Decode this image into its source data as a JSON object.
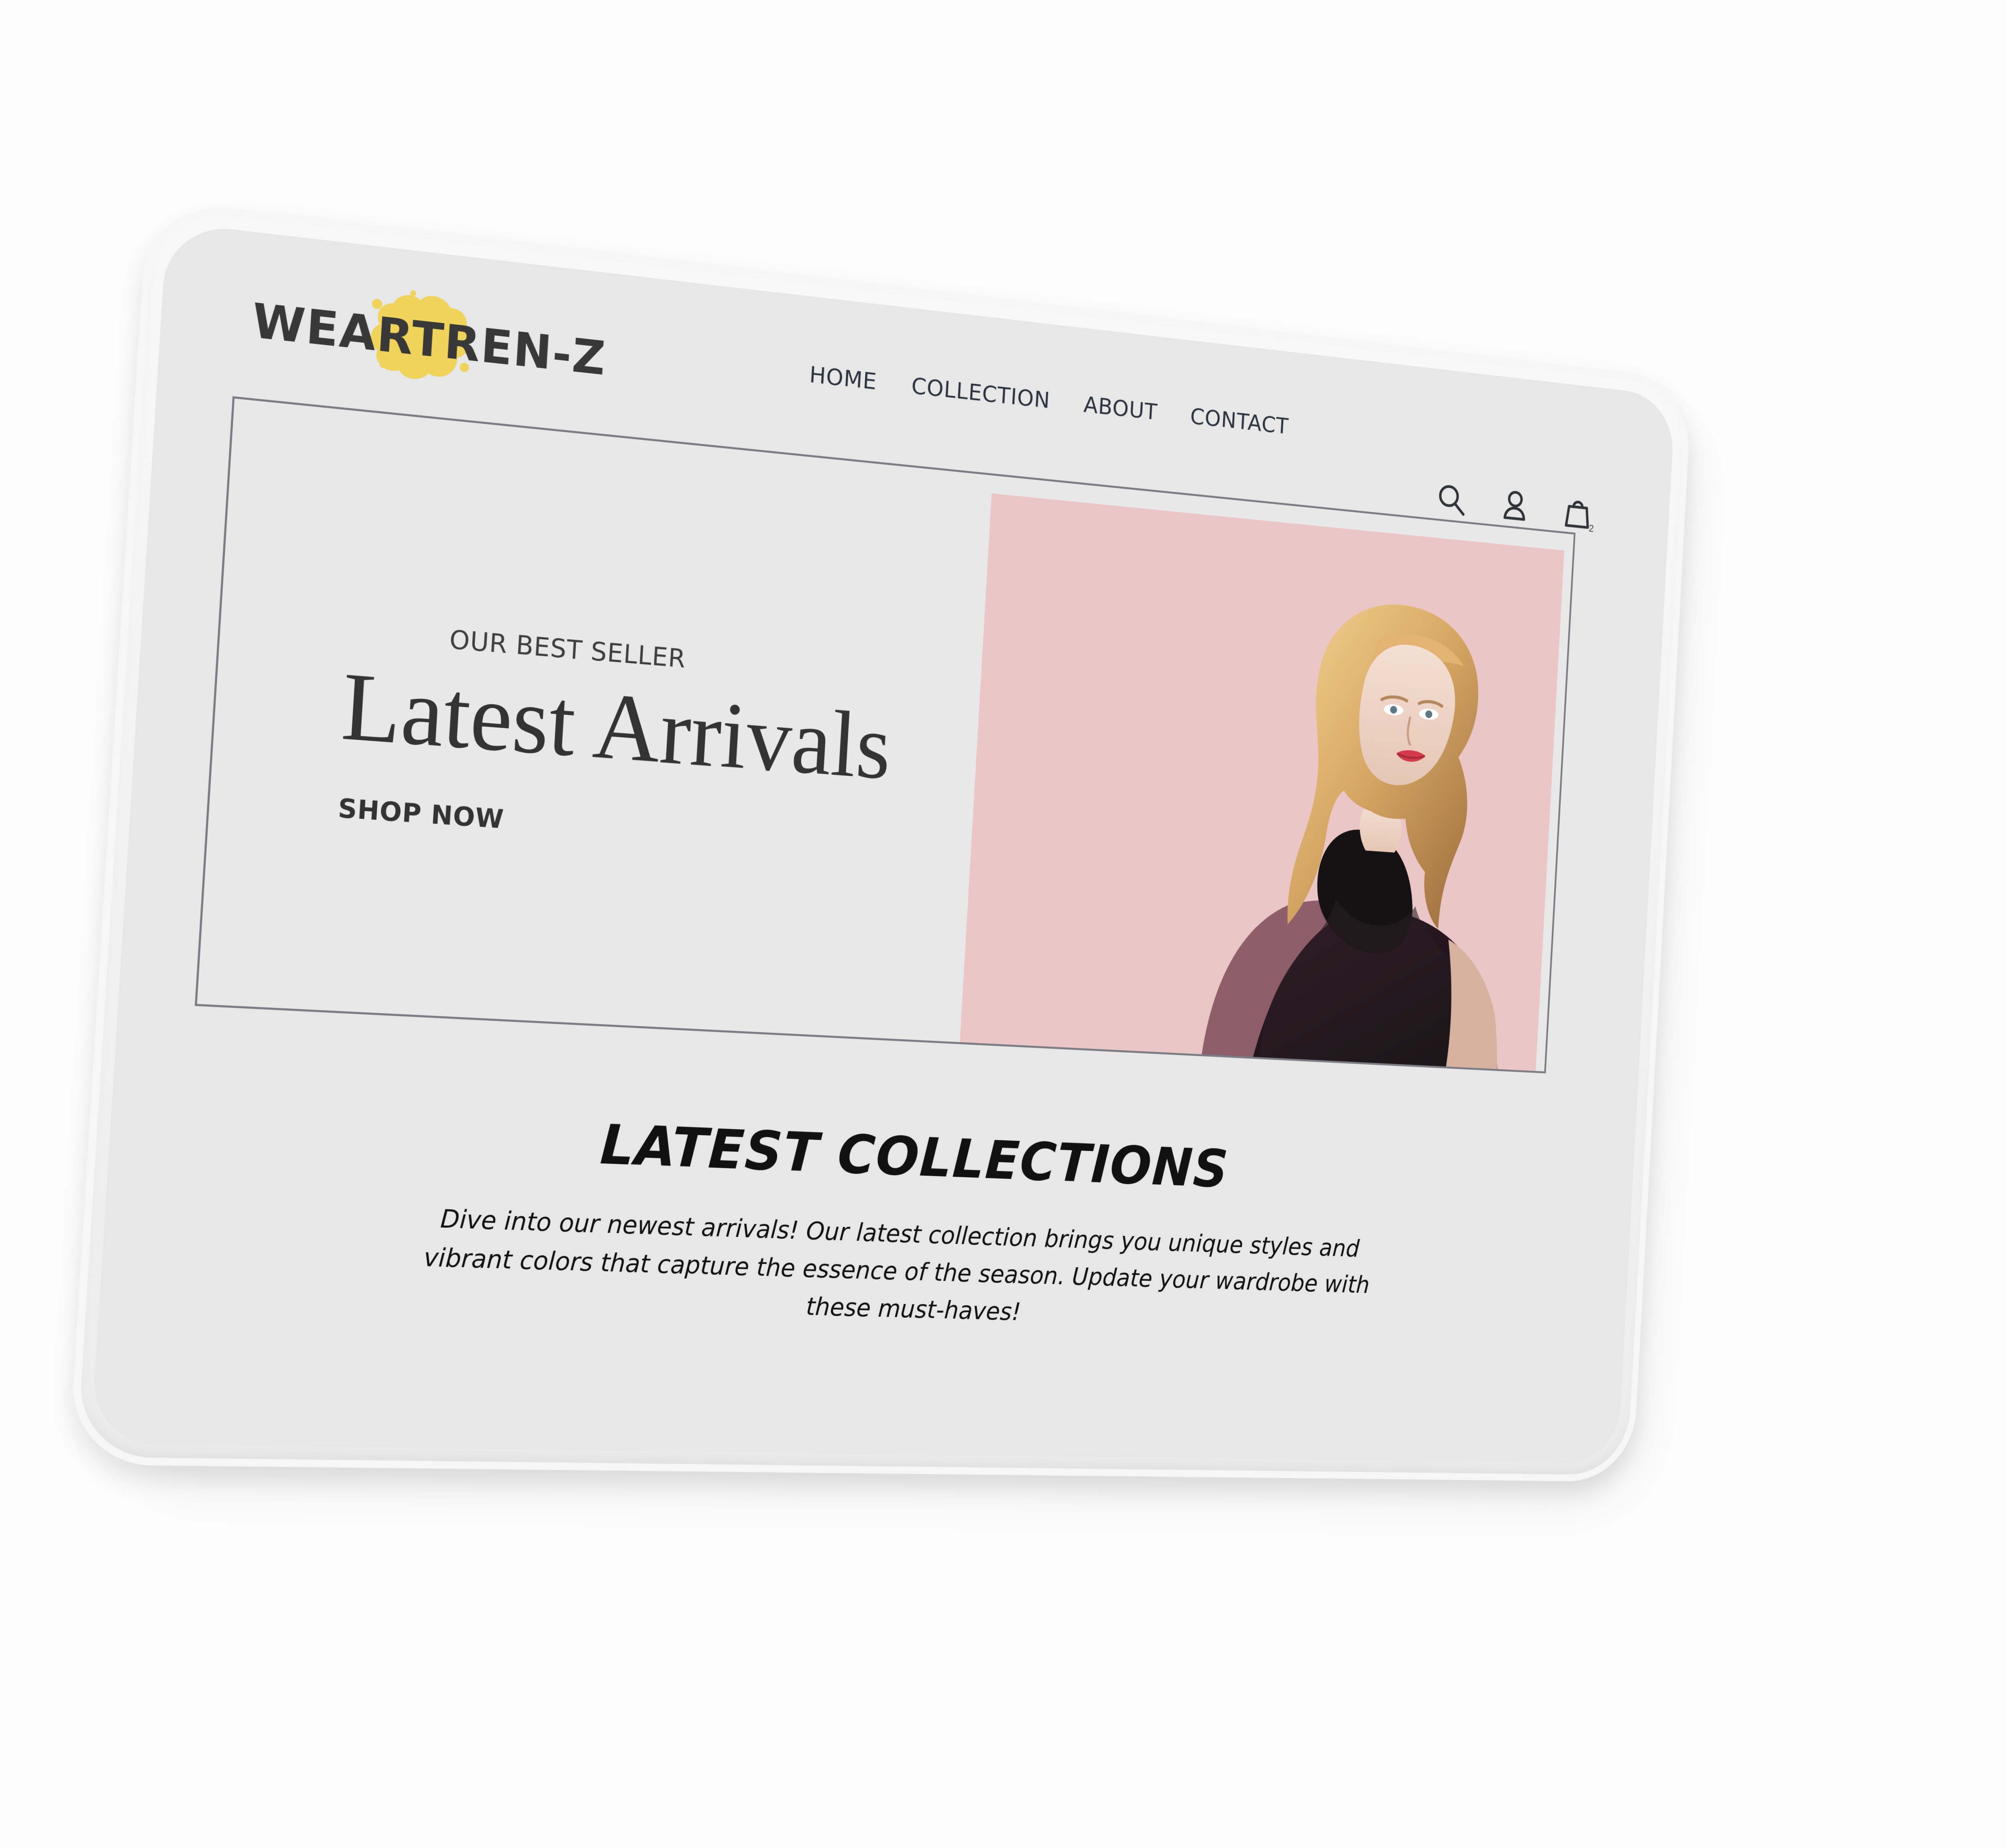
{
  "brand": {
    "logo_text": "WEARTREN-Z"
  },
  "nav": {
    "items": [
      {
        "label": "HOME"
      },
      {
        "label": "COLLECTION"
      },
      {
        "label": "ABOUT"
      },
      {
        "label": "CONTACT"
      }
    ]
  },
  "header_icons": {
    "search": "search-icon",
    "user": "user-icon",
    "cart": "shopping-bag-icon",
    "cart_count": "2"
  },
  "hero": {
    "kicker": "OUR BEST SELLER",
    "title": "Latest Arrivals",
    "cta": "SHOP NOW"
  },
  "collections": {
    "title": "LATEST COLLECTIONS",
    "description": "Dive into our newest arrivals! Our latest collection brings you unique styles and vibrant colors that capture the essence of the season. Update your wardrobe with these must-haves!"
  },
  "colors": {
    "screen_background": "#e7e7e8",
    "hero_right_background": "#ebc6c6",
    "logo_splash": "#f0d35a",
    "text_dark": "#333333"
  }
}
